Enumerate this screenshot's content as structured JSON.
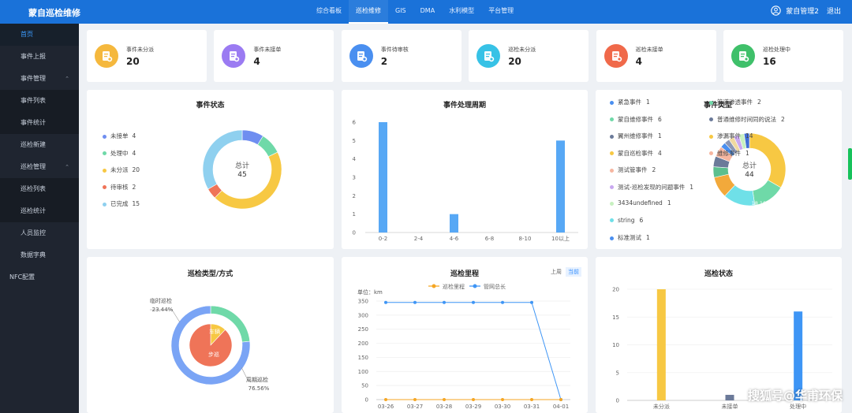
{
  "header": {
    "brand": "蒙自巡检维修",
    "nav": [
      "综合看板",
      "巡检维修",
      "GIS",
      "DMA",
      "水利模型",
      "平台管理"
    ],
    "active_nav": 1,
    "user": "蒙自管理2",
    "logout": "退出"
  },
  "sidebar": {
    "items": [
      {
        "label": "首页",
        "kind": "active"
      },
      {
        "label": "事件上报",
        "kind": "item"
      },
      {
        "label": "事件管理",
        "kind": "group"
      },
      {
        "label": "事件列表",
        "kind": "sub"
      },
      {
        "label": "事件统计",
        "kind": "sub"
      },
      {
        "label": "巡检新建",
        "kind": "item"
      },
      {
        "label": "巡检管理",
        "kind": "group"
      },
      {
        "label": "巡检列表",
        "kind": "sub"
      },
      {
        "label": "巡检统计",
        "kind": "sub"
      },
      {
        "label": "人员监控",
        "kind": "item"
      },
      {
        "label": "数据字典",
        "kind": "item"
      },
      {
        "label": "NFC配置",
        "kind": "nfc"
      }
    ]
  },
  "stats": [
    {
      "label": "事件未分派",
      "value": "20",
      "color": "#f5b83d",
      "icon": "clipboard-arrow-icon"
    },
    {
      "label": "事件未接单",
      "value": "4",
      "color": "#9b7bf2",
      "icon": "clipboard-x-icon"
    },
    {
      "label": "事件待审核",
      "value": "2",
      "color": "#4a8ff0",
      "icon": "clipboard-clock-icon"
    },
    {
      "label": "巡检未分派",
      "value": "20",
      "color": "#37c2e6",
      "icon": "worker-arrow-icon"
    },
    {
      "label": "巡检未接单",
      "value": "4",
      "color": "#f0694a",
      "icon": "worker-x-icon"
    },
    {
      "label": "巡检处理中",
      "value": "16",
      "color": "#3fc06a",
      "icon": "worker-clock-icon"
    }
  ],
  "event_status": {
    "title": "事件状态",
    "total_label": "总计",
    "total": "45",
    "chart_data": {
      "type": "pie",
      "labels": [
        "未接单",
        "处理中",
        "未分派",
        "待审核",
        "已完成"
      ],
      "values": [
        4,
        4,
        20,
        2,
        15
      ],
      "colors": [
        "#6f8ef0",
        "#6fd9a8",
        "#f7c843",
        "#ef7458",
        "#8fd0ef"
      ]
    }
  },
  "event_cycle": {
    "title": "事件处理周期",
    "chart_data": {
      "type": "bar",
      "categories": [
        "0-2",
        "2-4",
        "4-6",
        "6-8",
        "8-10",
        "10以上"
      ],
      "values": [
        6,
        0,
        1,
        0,
        0,
        5
      ],
      "ylim": [
        0,
        6
      ],
      "yticks": [
        0,
        1,
        2,
        3,
        4,
        5,
        6
      ],
      "color": "#57a8f5"
    }
  },
  "event_type": {
    "title": "事件类型",
    "total_label": "总计",
    "total": "44",
    "legend_left": [
      {
        "name": "紧急事件",
        "value": "1",
        "color": "#4a8ff0"
      },
      {
        "name": "蒙自维修事件",
        "value": "6",
        "color": "#6fd9a8"
      },
      {
        "name": "翼州维修事件",
        "value": "1",
        "color": "#6b7a99"
      },
      {
        "name": "蒙自巡检事件",
        "value": "4",
        "color": "#f7c843"
      },
      {
        "name": "测试管事件",
        "value": "2",
        "color": "#f6b6a0"
      },
      {
        "name": "测试-巡检发现的问题事件",
        "value": "1",
        "color": "#c9a8f0"
      },
      {
        "name": "3434undefined",
        "value": "1",
        "color": "#c7f0c0"
      },
      {
        "name": "string",
        "value": "6",
        "color": "#6fe0e8"
      },
      {
        "name": "标准测试",
        "value": "1",
        "color": "#4a8ff0"
      }
    ],
    "legend_right": [
      {
        "name": "管道渗透事件",
        "value": "2",
        "color": "#6fd9a8"
      },
      {
        "name": "普通维修时间同的说法",
        "value": "2",
        "color": "#6b7a99"
      },
      {
        "name": "渗漏事件",
        "value": "14",
        "color": "#f7c843"
      },
      {
        "name": "维修事件",
        "value": "1",
        "color": "#f6b6a0"
      }
    ],
    "slice_labels": [
      "13.64%",
      "8.57%",
      "9.09%",
      "2.27%",
      "2.27%",
      "18.18%"
    ],
    "chart_data": {
      "type": "pie",
      "labels": [
        "渗漏事件",
        "蒙自维修事件",
        "string",
        "蒙自巡检事件",
        "管道渗透事件",
        "普通维修时间同的说法",
        "测试管事件",
        "紧急事件",
        "翼州维修事件",
        "维修事件",
        "测试-巡检发现的问题事件",
        "3434undefined",
        "标准测试"
      ],
      "values": [
        14,
        6,
        6,
        4,
        2,
        2,
        2,
        1,
        1,
        1,
        1,
        1,
        1
      ],
      "colors": [
        "#f7c843",
        "#6fd9a8",
        "#6fe0e8",
        "#f2a93b",
        "#5bbf8e",
        "#6b7a99",
        "#f6b6a0",
        "#4a8ff0",
        "#8b96b5",
        "#f0d9a0",
        "#c9a8f0",
        "#c7f0c0",
        "#3f6fd6"
      ]
    }
  },
  "inspection_type": {
    "title": "巡检类型/方式",
    "inner_labels": [
      "车辆",
      "步巡"
    ],
    "outer_labels": [
      {
        "name": "临时巡检",
        "pct": "23.44%"
      },
      {
        "name": "周期巡检",
        "pct": "76.56%"
      }
    ],
    "chart_data": {
      "type": "pie",
      "outer": {
        "labels": [
          "临时巡检",
          "周期巡检"
        ],
        "values": [
          23.44,
          76.56
        ],
        "colors": [
          "#6fd9a8",
          "#7aa4f5"
        ]
      },
      "inner": {
        "labels": [
          "车辆",
          "步巡"
        ],
        "values": [
          12,
          88
        ],
        "colors": [
          "#f7c843",
          "#ef7458"
        ]
      }
    }
  },
  "inspection_mileage": {
    "title": "巡检里程",
    "toggle_prev": "上周",
    "toggle_cur": "当前",
    "unit": "单位：km",
    "chart_data": {
      "type": "line",
      "x": [
        "03-26",
        "03-27",
        "03-28",
        "03-29",
        "03-30",
        "03-31",
        "04-01"
      ],
      "series": [
        {
          "name": "巡检里程",
          "values": [
            0,
            0,
            0,
            0,
            0,
            0,
            0
          ],
          "color": "#f5a623"
        },
        {
          "name": "管网总长",
          "values": [
            345,
            345,
            345,
            345,
            345,
            345,
            0
          ],
          "color": "#3e95f5"
        }
      ],
      "ylim": [
        0,
        350
      ],
      "yticks": [
        0,
        50,
        100,
        150,
        200,
        250,
        300,
        350
      ]
    }
  },
  "inspection_status": {
    "title": "巡检状态",
    "chart_data": {
      "type": "bar",
      "categories": [
        "未分派",
        "未接单",
        "处理中"
      ],
      "values": [
        20,
        1,
        16
      ],
      "colors": [
        "#f7c843",
        "#6b7a99",
        "#3e95f5"
      ],
      "ylim": [
        0,
        20
      ],
      "yticks": [
        0,
        5,
        10,
        15,
        20
      ]
    }
  },
  "watermark": "搜狐号@华甫环保"
}
